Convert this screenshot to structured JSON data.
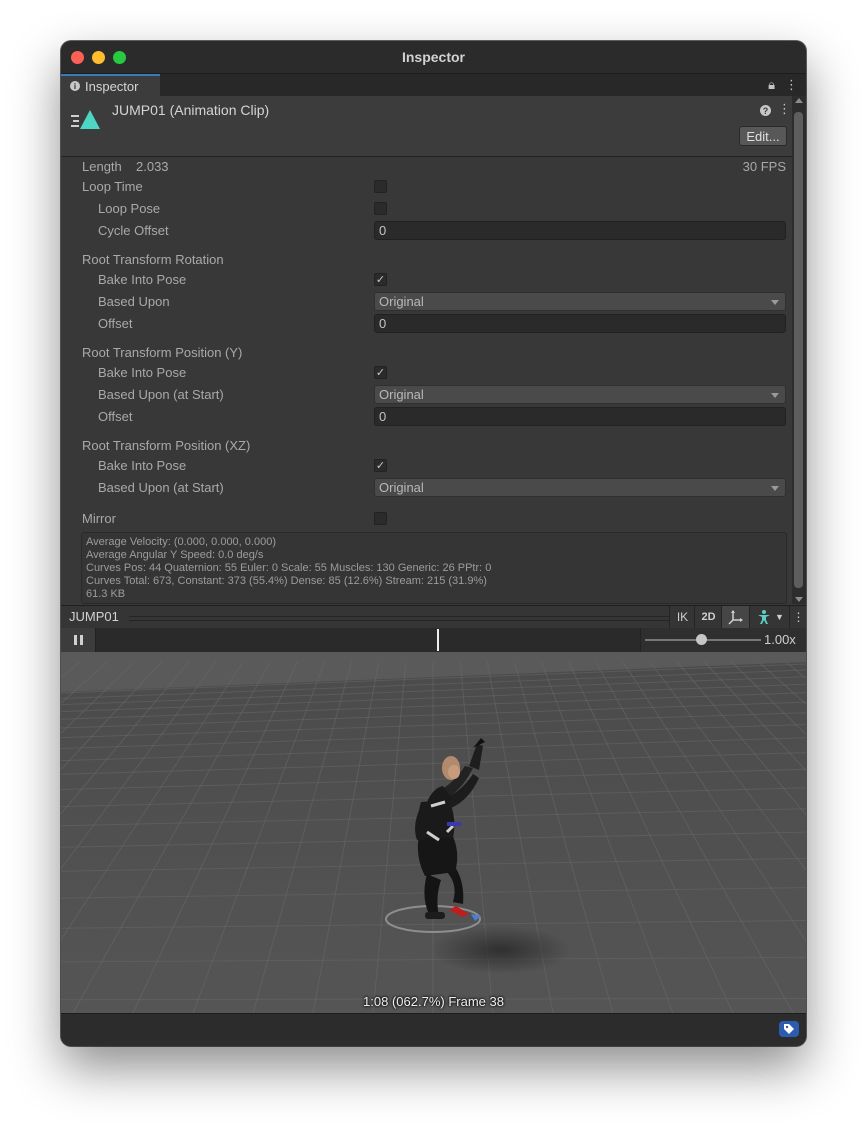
{
  "window": {
    "title": "Inspector"
  },
  "tab": {
    "label": "Inspector",
    "lock_icon": "lock-icon",
    "menu_icon": "kebab-menu-icon"
  },
  "header": {
    "clip_title": "JUMP01 (Animation Clip)",
    "edit_label": "Edit..."
  },
  "clip": {
    "length_label": "Length",
    "length_value": "2.033",
    "fps": "30 FPS"
  },
  "settings": {
    "loop_time": {
      "label": "Loop Time",
      "checked": false
    },
    "loop_pose": {
      "label": "Loop Pose",
      "checked": false
    },
    "cycle_offset": {
      "label": "Cycle Offset",
      "value": "0"
    },
    "root_rotation": {
      "header": "Root Transform Rotation",
      "bake_label": "Bake Into Pose",
      "bake_checked": true,
      "based_label": "Based Upon",
      "based_value": "Original",
      "offset_label": "Offset",
      "offset_value": "0"
    },
    "root_position_y": {
      "header": "Root Transform Position (Y)",
      "bake_label": "Bake Into Pose",
      "bake_checked": true,
      "based_label": "Based Upon (at Start)",
      "based_value": "Original",
      "offset_label": "Offset",
      "offset_value": "0"
    },
    "root_position_xz": {
      "header": "Root Transform Position (XZ)",
      "bake_label": "Bake Into Pose",
      "bake_checked": true,
      "based_label": "Based Upon (at Start)",
      "based_value": "Original"
    },
    "mirror": {
      "label": "Mirror",
      "checked": false
    }
  },
  "stats": {
    "line1": "Average Velocity: (0.000, 0.000, 0.000)",
    "line2": "Average Angular Y Speed: 0.0 deg/s",
    "line3": "Curves Pos: 44 Quaternion: 55 Euler: 0 Scale: 55 Muscles: 130 Generic: 26 PPtr: 0",
    "line4": "Curves Total: 673, Constant: 373 (55.4%) Dense: 85 (12.6%) Stream: 215 (31.9%)",
    "line5": "61.3 KB"
  },
  "preview": {
    "clip_name": "JUMP01",
    "ik_label": "IK",
    "two_d_label": "2D",
    "speed": "1.00x",
    "speed_fraction": 0.48,
    "playhead_fraction": 0.627,
    "frame_label": "1:08 (062.7%) Frame 38"
  },
  "colors": {
    "accent": "#3a79bb",
    "background": "#383838",
    "viewport": "#505050"
  }
}
